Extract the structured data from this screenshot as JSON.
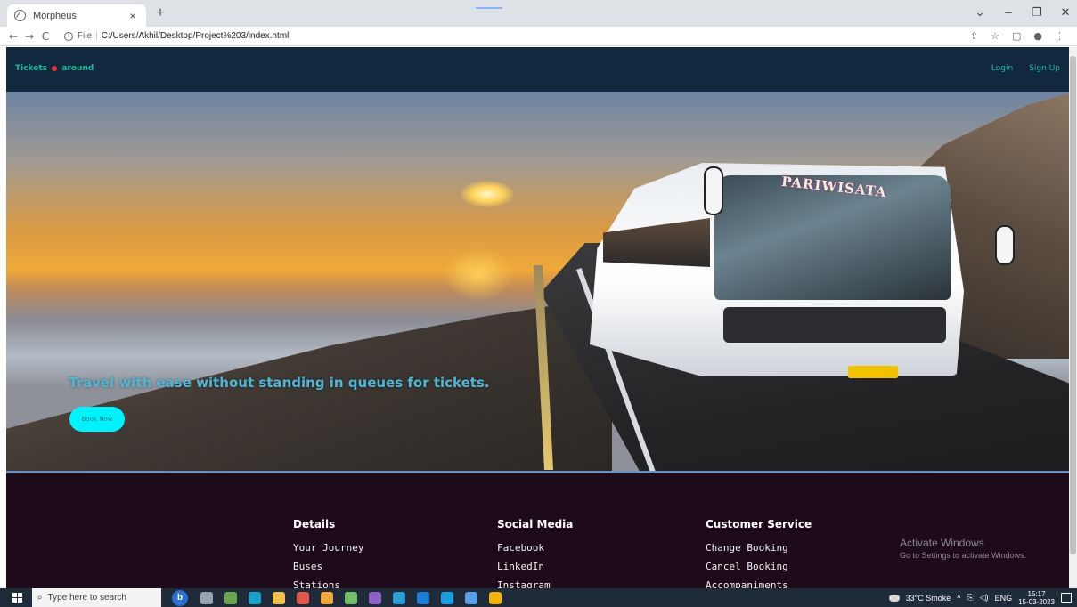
{
  "browser": {
    "tab_title": "Morpheus",
    "tab_close": "×",
    "new_tab": "+",
    "address_prefix": "File",
    "address_separator": "|",
    "address": "C:/Users/Akhil/Desktop/Project%203/index.html",
    "window_controls": {
      "dropdown": "⌄",
      "minimize": "–",
      "maximize": "❐",
      "close": "✕"
    },
    "nav": {
      "back": "←",
      "forward": "→",
      "reload": "C"
    },
    "toolbar_icons": [
      "share-icon",
      "star-icon",
      "sidebar-icon",
      "profile-icon",
      "menu-icon"
    ]
  },
  "site": {
    "brand_left": "Tickets",
    "brand_right": "around",
    "brand_color": "#1abc9c",
    "brand_dot_color": "#e53935",
    "nav_links": [
      "Login",
      "Sign Up"
    ],
    "nav_bg": "#12283f"
  },
  "hero": {
    "bus_sign": "PARIWISATA",
    "tagline": "Travel with ease without standing in queues for tickets.",
    "tagline_color": "#4fb6d8",
    "book_button": "Book Now",
    "book_button_color": "#00f2ff"
  },
  "footer": {
    "bg": "#1e0b19",
    "columns": [
      {
        "heading": "Details",
        "items": [
          "Your Journey",
          "Buses",
          "Stations"
        ]
      },
      {
        "heading": "Social Media",
        "items": [
          "Facebook",
          "LinkedIn",
          "Instagram"
        ]
      },
      {
        "heading": "Customer Service",
        "items": [
          "Change Booking",
          "Cancel Booking",
          "Accompaniments"
        ]
      }
    ],
    "activate_title": "Activate Windows",
    "activate_sub": "Go to Settings to activate Windows."
  },
  "taskbar": {
    "search_placeholder": "Type here to search",
    "bing_label": "b",
    "weather": "33°C  Smoke",
    "tray_symbols": "^",
    "language": "ENG",
    "time": "15:17",
    "date": "15-03-2023",
    "app_icons": [
      {
        "name": "task-view-icon",
        "color": "#9aa4ae"
      },
      {
        "name": "app-icon",
        "color": "#6aa84f"
      },
      {
        "name": "edge-icon",
        "color": "#1aa1c9"
      },
      {
        "name": "file-explorer-icon",
        "color": "#f2c14e"
      },
      {
        "name": "chrome-color-icon",
        "color": "#e5574b"
      },
      {
        "name": "outlook-icon",
        "color": "#f3a93a"
      },
      {
        "name": "notepad-icon",
        "color": "#73c06b"
      },
      {
        "name": "visual-studio-icon",
        "color": "#8c62c9"
      },
      {
        "name": "app-icon-2",
        "color": "#2e9ed8"
      },
      {
        "name": "vscode-icon",
        "color": "#1f7fd6"
      },
      {
        "name": "skype-icon",
        "color": "#1b9de2"
      },
      {
        "name": "app-icon-3",
        "color": "#5aa0e6"
      },
      {
        "name": "chrome-icon",
        "color": "#f5b400"
      }
    ]
  }
}
